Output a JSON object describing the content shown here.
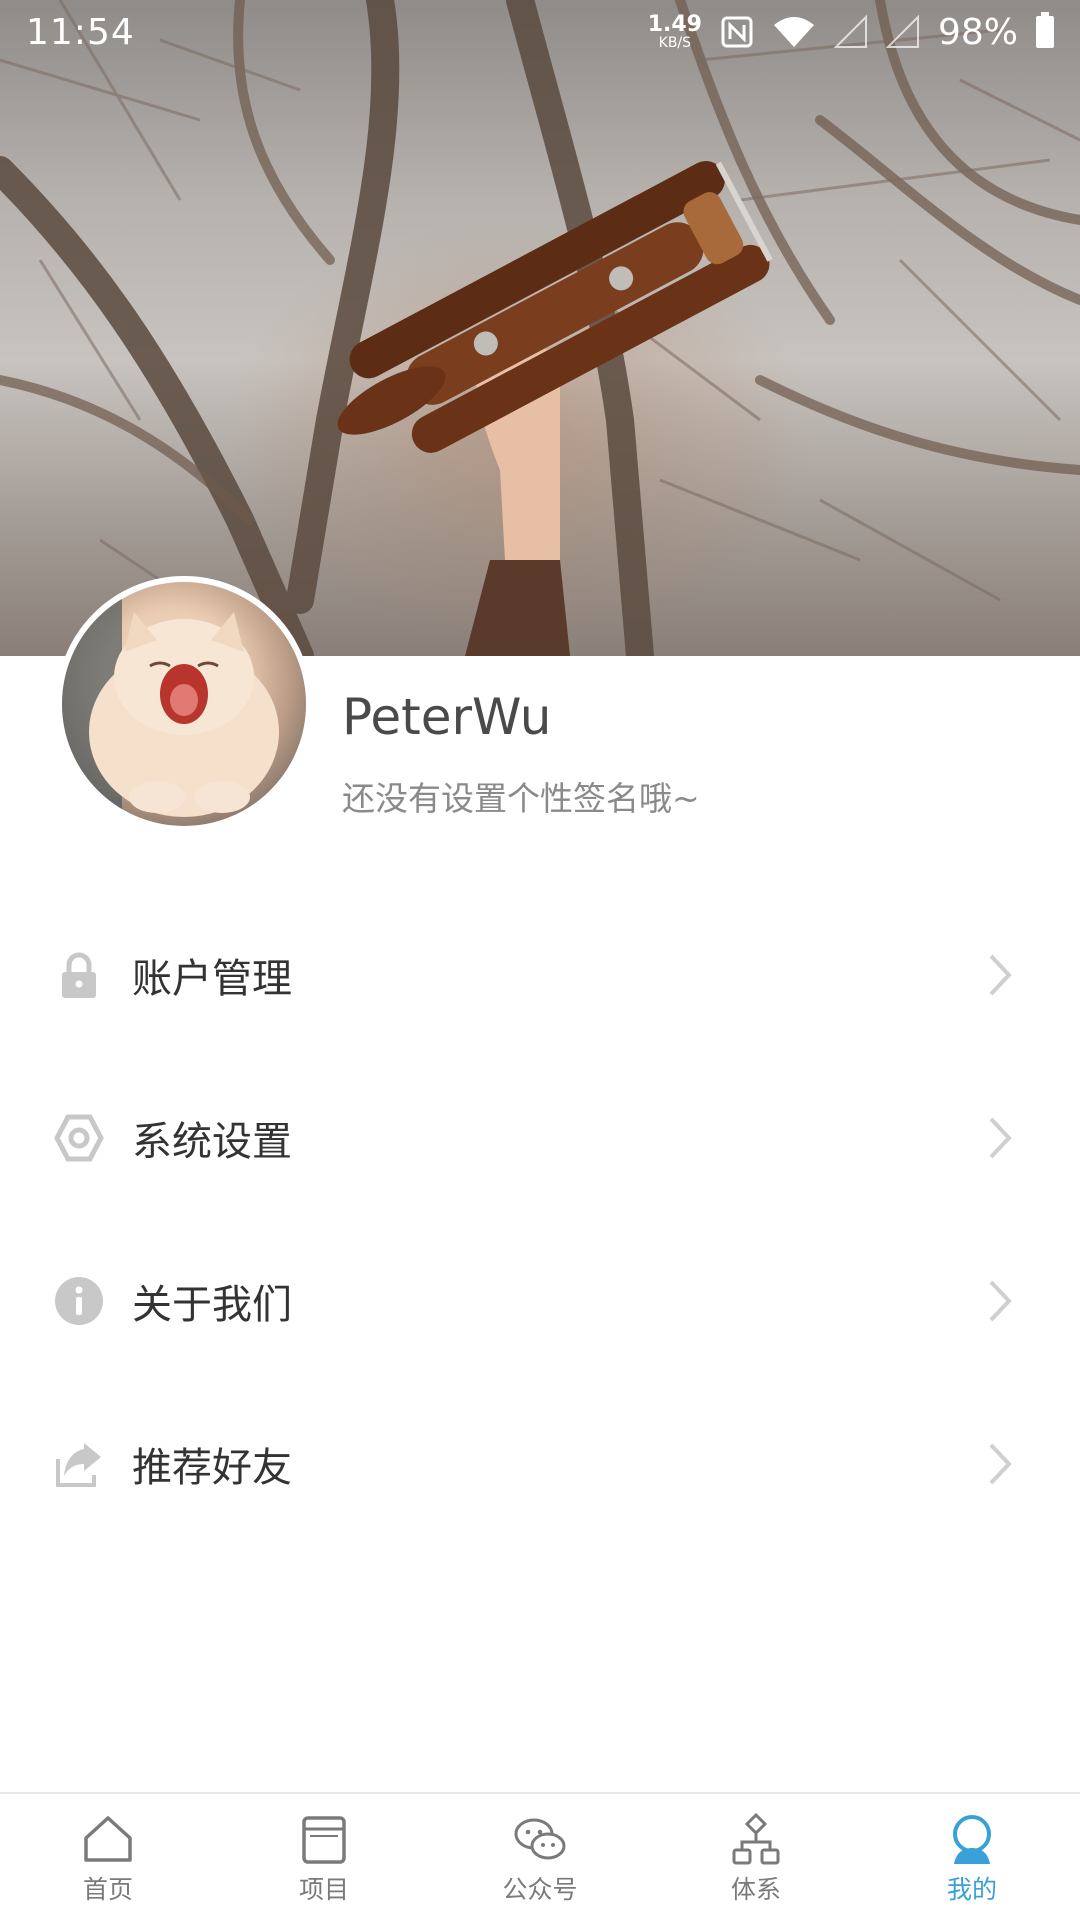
{
  "status_bar": {
    "time": "11:54",
    "net_speed_value": "1.49",
    "net_speed_unit": "KB/S",
    "battery": "98%"
  },
  "profile": {
    "name": "PeterWu",
    "signature": "还没有设置个性签名哦~"
  },
  "menu": {
    "items": [
      {
        "label": "账户管理",
        "icon": "lock-icon"
      },
      {
        "label": "系统设置",
        "icon": "settings-hexagon-icon"
      },
      {
        "label": "关于我们",
        "icon": "info-icon"
      },
      {
        "label": "推荐好友",
        "icon": "share-icon"
      }
    ]
  },
  "bottom_nav": {
    "items": [
      {
        "label": "首页",
        "icon": "home-icon",
        "active": false
      },
      {
        "label": "项目",
        "icon": "project-icon",
        "active": false
      },
      {
        "label": "公众号",
        "icon": "wechat-icon",
        "active": false
      },
      {
        "label": "体系",
        "icon": "hierarchy-icon",
        "active": false
      },
      {
        "label": "我的",
        "icon": "profile-bulb-icon",
        "active": true
      }
    ]
  },
  "colors": {
    "accent": "#3aa0d8",
    "menu_icon": "#c8c8c8",
    "text_primary": "#333333",
    "text_secondary": "#8a8a8a"
  }
}
